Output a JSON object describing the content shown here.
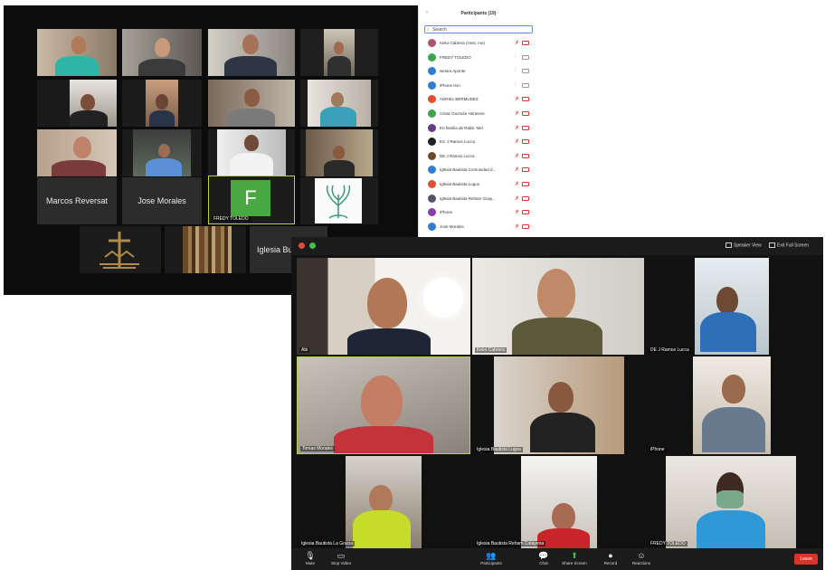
{
  "gallery": {
    "tiles": [
      {
        "label": ""
      },
      {
        "label": ""
      },
      {
        "label": ""
      },
      {
        "label": ""
      },
      {
        "label": ""
      },
      {
        "label": ""
      },
      {
        "label": ""
      },
      {
        "label": ""
      },
      {
        "label": ""
      },
      {
        "label": ""
      },
      {
        "label": ""
      },
      {
        "label": ""
      }
    ],
    "name_tiles": [
      "Marcos Reversat",
      "Jose Morales",
      "Iglesia Bu"
    ],
    "avatar_letter": "F",
    "avatar_label": "FREDY TOLEDO"
  },
  "participants": {
    "title": "Participants (19)",
    "collapse_icon": "chevron-left-icon",
    "search_placeholder": "Search",
    "list": [
      {
        "name": "Keko Cabrera (Host, me)",
        "color": "#b0506a",
        "muted": true
      },
      {
        "name": "FREDY TOLEDO",
        "color": "#3aa84a",
        "muted": false
      },
      {
        "name": "Nestor Aponte",
        "color": "#2c7fd6",
        "muted": false
      },
      {
        "name": "iPhone Isrn",
        "color": "#2c7fd6",
        "muted": false
      },
      {
        "name": "ADRIEL BERMUDEZ",
        "color": "#e0502c",
        "muted": true
      },
      {
        "name": "César Guzmán Herasme",
        "color": "#3aa84a",
        "muted": true
      },
      {
        "name": "En familia de Rabb. Mel",
        "color": "#6a3a8a",
        "muted": true
      },
      {
        "name": "Ed. J Ramos Lucca",
        "color": "#222222",
        "muted": true
      },
      {
        "name": "DE J Ramos Lucca",
        "color": "#6b4a2a",
        "muted": true
      },
      {
        "name": "Iglesia Bautista Comunidad d...",
        "color": "#2c7fd6",
        "muted": true
      },
      {
        "name": "Iglesia Bautista Lugos",
        "color": "#e0502c",
        "muted": true
      },
      {
        "name": "Iglesia Bautista Reham Guay...",
        "color": "#556",
        "muted": true
      },
      {
        "name": "iPhone",
        "color": "#8a3ab0",
        "muted": true
      },
      {
        "name": "Jose Morales",
        "color": "#2c7fd6",
        "muted": true
      }
    ]
  },
  "speaker_window": {
    "topbar": {
      "speaker_view": "Speaker View",
      "exit_full": "Exit Full Screen"
    },
    "tiles": [
      {
        "label": "Abi"
      },
      {
        "label": "Keko Cabrera"
      },
      {
        "label": "DE J Ramos Lucca"
      },
      {
        "label": "Tomas Morales"
      },
      {
        "label": "Iglesia Bautista Lugos"
      },
      {
        "label": "iPhone"
      },
      {
        "label": "Iglesia Bautista La Gracia"
      },
      {
        "label": "Iglesia Bautista Reham Catayena"
      },
      {
        "label": "FREDY TOLEDO"
      }
    ],
    "toolbar": {
      "mute": "Mute",
      "stop_video": "Stop Video",
      "participants": "Participants",
      "chat": "Chat",
      "share_screen": "Share Screen",
      "record": "Record",
      "reactions": "Reactions",
      "leave": "Leave"
    }
  }
}
